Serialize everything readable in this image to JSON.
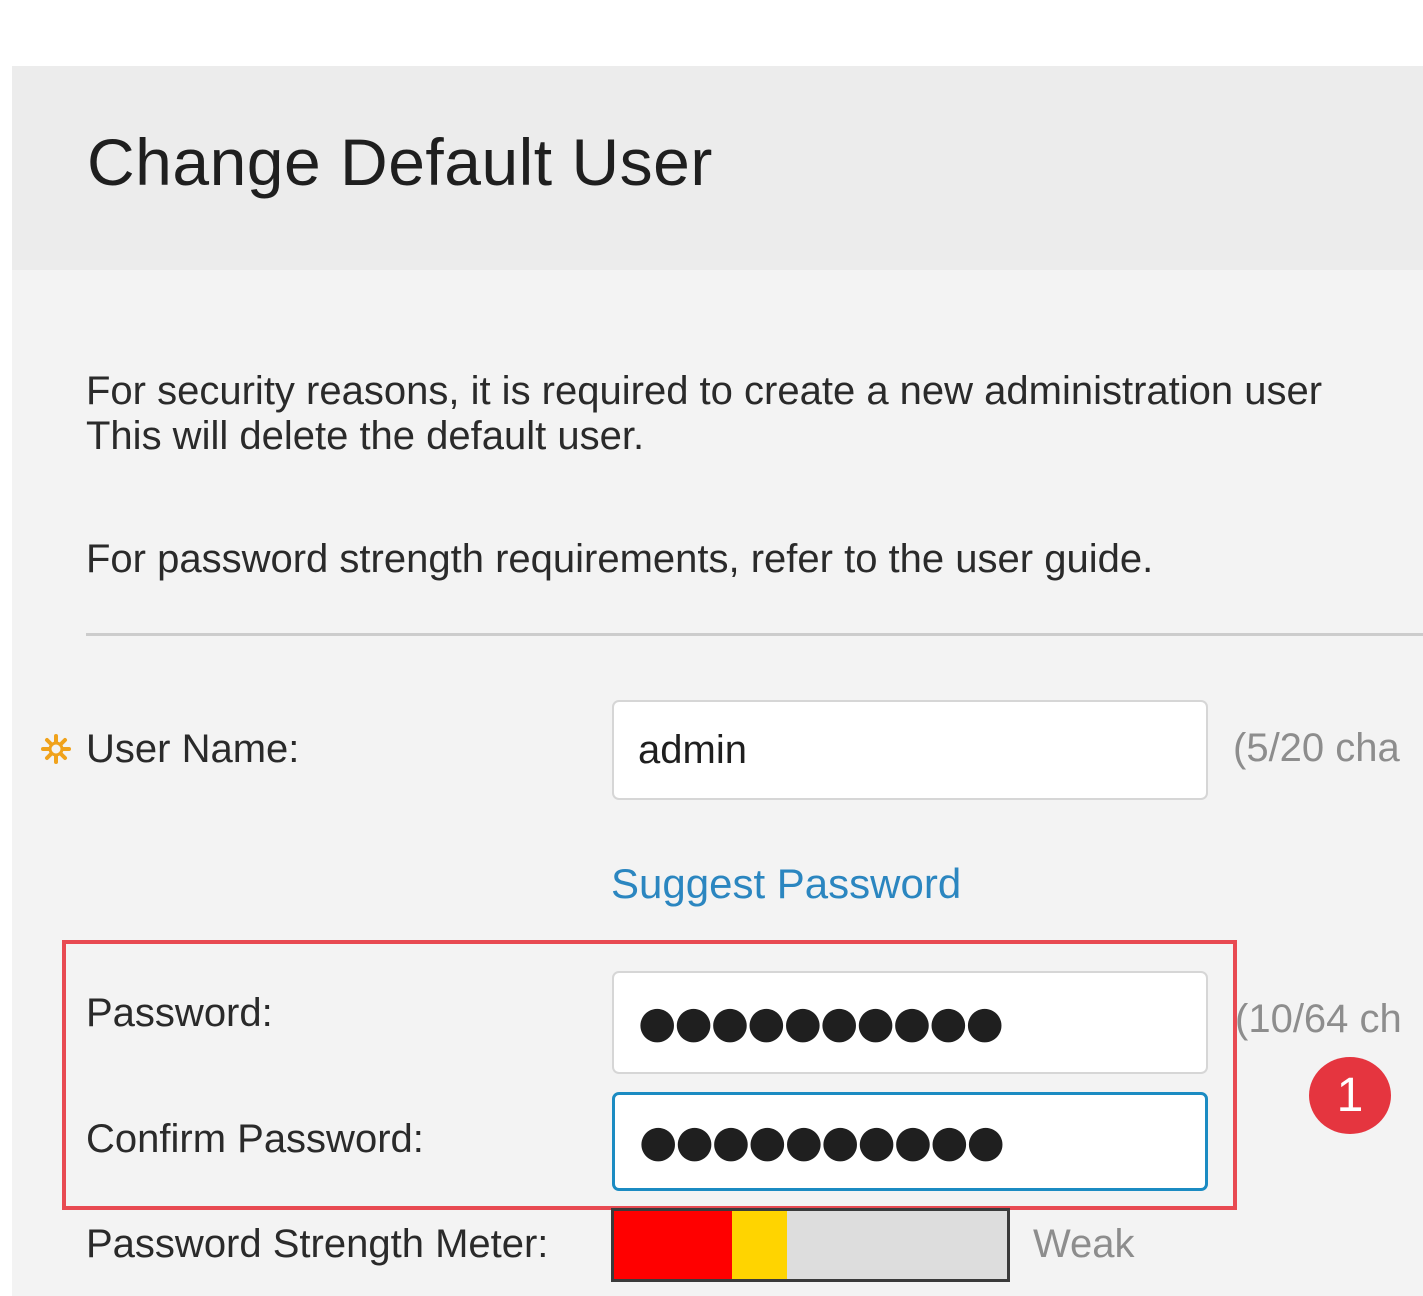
{
  "dialog": {
    "title": "Change Default User",
    "intro_line1": "For security reasons, it is required to create a new administration user",
    "intro_line2": "This will delete the default user.",
    "strength_note": "For password strength requirements, refer to the user guide."
  },
  "form": {
    "username": {
      "label": "User Name:",
      "value": "admin",
      "counter": "(5/20 cha",
      "required": true
    },
    "suggest_password_label": "Suggest Password",
    "password": {
      "label": "Password:",
      "masked_value": "●●●●●●●●●●",
      "counter": "(10/64 ch"
    },
    "confirm_password": {
      "label": "Confirm Password:",
      "masked_value": "●●●●●●●●●●"
    },
    "strength_meter": {
      "label": "Password Strength Meter:",
      "level_label": "Weak",
      "filled_fraction": 0.44,
      "segments": [
        {
          "color": "#ff0000",
          "fraction": 0.3
        },
        {
          "color": "#ffd400",
          "fraction": 0.14
        }
      ],
      "empty_color": "#dddddd"
    }
  },
  "annotation": {
    "step_number": "1",
    "highlight_color": "#e84a52",
    "badge_color": "#e5353f"
  },
  "colors": {
    "link": "#2b86c0",
    "focus_border": "#1b8bc2",
    "required_icon": "#f0a21b"
  },
  "icons": {
    "required": "required-asterisk-icon"
  }
}
